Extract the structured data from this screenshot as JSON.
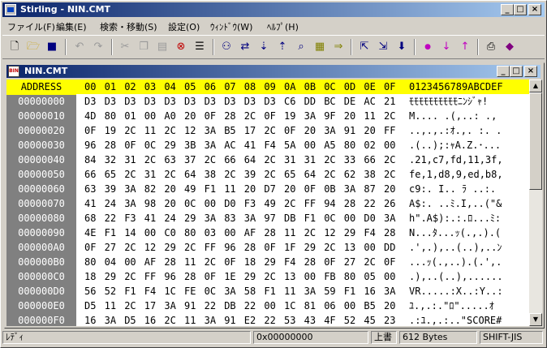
{
  "window": {
    "title": "Stirling - NIN.CMT",
    "icon": "stirling-app-icon",
    "controls": [
      "minimize",
      "maximize",
      "close"
    ]
  },
  "menu": [
    "ファイル(F)",
    "編集(E)",
    "検索・移動(S)",
    "設定(O)",
    "ｳｨﾝﾄﾞｳ(W)",
    "ﾍﾙﾌﾟ(H)"
  ],
  "toolbar_icons": [
    "new-file-icon",
    "open-folder-icon",
    "save-icon",
    "undo-icon",
    "redo-icon",
    "cut-icon",
    "copy-icon",
    "paste-icon",
    "delete-icon",
    "select-all-icon",
    "find-icon",
    "find-replace-icon",
    "find-next-icon",
    "find-prev-icon",
    "find-hex-icon",
    "compare-icon",
    "jump-icon",
    "insert-block-icon",
    "fill-block-icon",
    "fill-down-icon",
    "mark-icon",
    "mark-next-icon",
    "mark-prev-icon",
    "print-icon",
    "settings-icon"
  ],
  "child": {
    "title": "NIN.CMT",
    "icon_label": "BIN"
  },
  "hex": {
    "header_label": "ADDRESS",
    "columns": [
      "00",
      "01",
      "02",
      "03",
      "04",
      "05",
      "06",
      "07",
      "08",
      "09",
      "0A",
      "0B",
      "0C",
      "0D",
      "0E",
      "0F"
    ],
    "ascii_header": "0123456789ABCDEF",
    "rows": [
      {
        "addr": "00000000",
        "bytes": [
          "D3",
          "D3",
          "D3",
          "D3",
          "D3",
          "D3",
          "D3",
          "D3",
          "D3",
          "D3",
          "C6",
          "DD",
          "BC",
          "DE",
          "AC",
          "21"
        ],
        "ascii": "ﾓﾓﾓﾓﾓﾓﾓﾓﾓﾓﾆﾝｼﾞｬ!"
      },
      {
        "addr": "00000010",
        "bytes": [
          "4D",
          "80",
          "01",
          "00",
          "A0",
          "20",
          "0F",
          "28",
          "2C",
          "0F",
          "19",
          "3A",
          "9F",
          "20",
          "11",
          "2C"
        ],
        "ascii": "M.... .(,..: .,"
      },
      {
        "addr": "00000020",
        "bytes": [
          "0F",
          "19",
          "2C",
          "11",
          "2C",
          "12",
          "3A",
          "B5",
          "17",
          "2C",
          "0F",
          "20",
          "3A",
          "91",
          "20",
          "FF"
        ],
        "ascii": "..,.,.:ｵ.,. :. ."
      },
      {
        "addr": "00000030",
        "bytes": [
          "96",
          "28",
          "0F",
          "0C",
          "29",
          "3B",
          "3A",
          "AC",
          "41",
          "F4",
          "5A",
          "00",
          "A5",
          "80",
          "02",
          "00"
        ],
        "ascii": ".(..);:ｬA.Z.･..."
      },
      {
        "addr": "00000040",
        "bytes": [
          "84",
          "32",
          "31",
          "2C",
          "63",
          "37",
          "2C",
          "66",
          "64",
          "2C",
          "31",
          "31",
          "2C",
          "33",
          "66",
          "2C"
        ],
        "ascii": ".21,c7,fd,11,3f,"
      },
      {
        "addr": "00000050",
        "bytes": [
          "66",
          "65",
          "2C",
          "31",
          "2C",
          "64",
          "38",
          "2C",
          "39",
          "2C",
          "65",
          "64",
          "2C",
          "62",
          "38",
          "2C"
        ],
        "ascii": "fe,1,d8,9,ed,b8,"
      },
      {
        "addr": "00000060",
        "bytes": [
          "63",
          "39",
          "3A",
          "82",
          "20",
          "49",
          "F1",
          "11",
          "20",
          "D7",
          "20",
          "0F",
          "0B",
          "3A",
          "87",
          "20"
        ],
        "ascii": "c9:. I.. ﾗ ..:. "
      },
      {
        "addr": "00000070",
        "bytes": [
          "41",
          "24",
          "3A",
          "98",
          "20",
          "0C",
          "00",
          "D0",
          "F3",
          "49",
          "2C",
          "FF",
          "94",
          "28",
          "22",
          "26"
        ],
        "ascii": "A$:. ..ﾐ.I,..(\"&"
      },
      {
        "addr": "00000080",
        "bytes": [
          "68",
          "22",
          "F3",
          "41",
          "24",
          "29",
          "3A",
          "83",
          "3A",
          "97",
          "DB",
          "F1",
          "0C",
          "00",
          "D0",
          "3A"
        ],
        "ascii": "h\".A$):.:.ﾛ...ﾐ:"
      },
      {
        "addr": "00000090",
        "bytes": [
          "4E",
          "F1",
          "14",
          "00",
          "C0",
          "80",
          "03",
          "00",
          "AF",
          "28",
          "11",
          "2C",
          "12",
          "29",
          "F4",
          "28"
        ],
        "ascii": "N...ﾀ...ｯ(.,.).("
      },
      {
        "addr": "000000A0",
        "bytes": [
          "0F",
          "27",
          "2C",
          "12",
          "29",
          "2C",
          "FF",
          "96",
          "28",
          "0F",
          "1F",
          "29",
          "2C",
          "13",
          "00",
          "DD"
        ],
        "ascii": ".',.),..(..),..ﾝ"
      },
      {
        "addr": "000000B0",
        "bytes": [
          "80",
          "04",
          "00",
          "AF",
          "28",
          "11",
          "2C",
          "0F",
          "18",
          "29",
          "F4",
          "28",
          "0F",
          "27",
          "2C",
          "0F"
        ],
        "ascii": "...ｯ(.,..).(.',."
      },
      {
        "addr": "000000C0",
        "bytes": [
          "18",
          "29",
          "2C",
          "FF",
          "96",
          "28",
          "0F",
          "1E",
          "29",
          "2C",
          "13",
          "00",
          "FB",
          "80",
          "05",
          "00"
        ],
        "ascii": ".),..(..),......"
      },
      {
        "addr": "000000D0",
        "bytes": [
          "56",
          "52",
          "F1",
          "F4",
          "1C",
          "FE",
          "0C",
          "3A",
          "58",
          "F1",
          "11",
          "3A",
          "59",
          "F1",
          "16",
          "3A"
        ],
        "ascii": "VR.....:X..:Y..:"
      },
      {
        "addr": "000000E0",
        "bytes": [
          "D5",
          "11",
          "2C",
          "17",
          "3A",
          "91",
          "22",
          "DB",
          "22",
          "00",
          "1C",
          "81",
          "06",
          "00",
          "B5",
          "20"
        ],
        "ascii": "ﾕ.,.:.\"ﾛ\".....ｵ "
      },
      {
        "addr": "000000F0",
        "bytes": [
          "16",
          "3A",
          "D5",
          "16",
          "2C",
          "11",
          "3A",
          "91",
          "E2",
          "22",
          "53",
          "43",
          "4F",
          "52",
          "45",
          "23"
        ],
        "ascii": ".:ﾕ.,.:..\"SCORE#"
      }
    ]
  },
  "status": {
    "mode": "ﾚﾃﾞｨ",
    "offset": "0x00000000",
    "overwrite": "上書",
    "size": "612 Bytes",
    "encoding": "SHIFT-JIS"
  }
}
